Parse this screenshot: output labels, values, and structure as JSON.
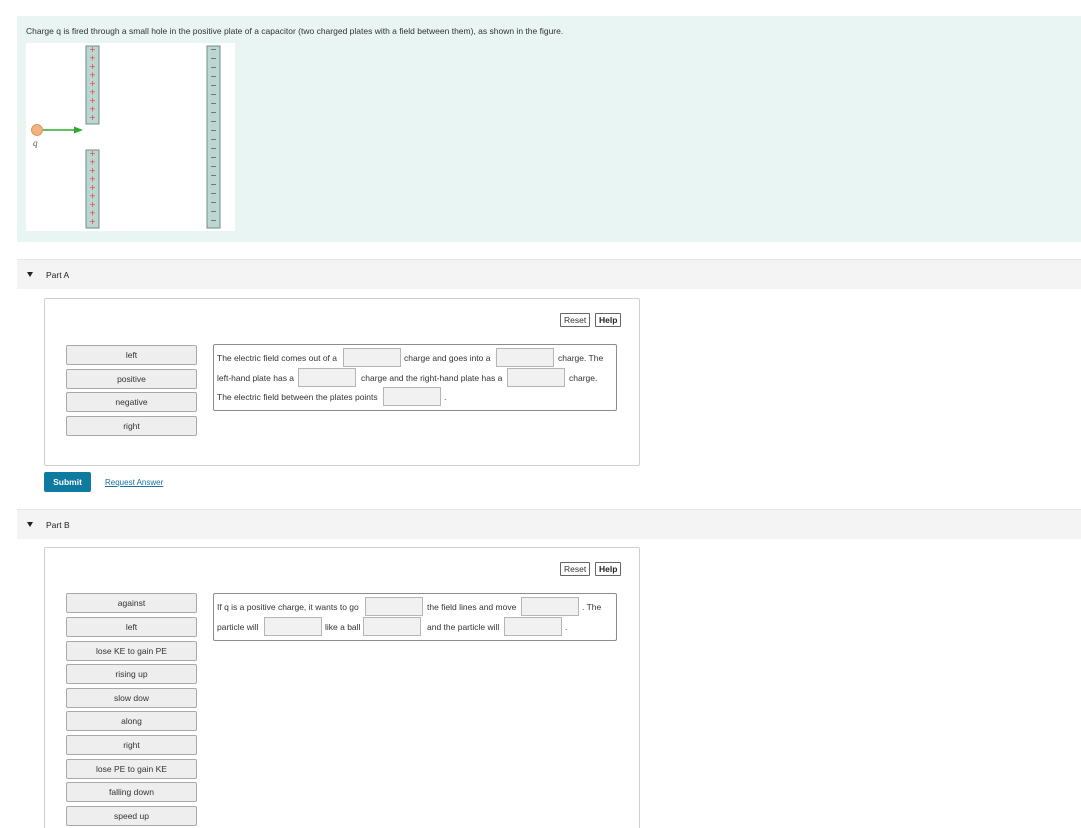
{
  "intro": {
    "text": "Charge q is fired through a small hole in the positive plate of a capacitor (two charged plates with a field between them), as shown in the figure.",
    "figure": {
      "charge_label": "q",
      "plus_sign": "+",
      "minus_sign": "−",
      "arrow_color": "#2eaa2e",
      "charge_color": "#f5b27f"
    }
  },
  "part_a": {
    "title": "Part A",
    "reset": "Reset",
    "help": "Help",
    "chips": [
      "left",
      "positive",
      "negative",
      "right"
    ],
    "sentences": [
      [
        "The electric field comes out of a",
        "charge and goes into a",
        "charge. The"
      ],
      [
        "left-hand plate has a",
        "charge and the right-hand plate has a",
        "charge."
      ],
      [
        "The electric field between the plates points",
        "."
      ]
    ]
  },
  "actions": {
    "submit": "Submit",
    "request_answer": "Request Answer"
  },
  "part_b": {
    "title": "Part B",
    "reset": "Reset",
    "help": "Help",
    "chips": [
      "against",
      "left",
      "lose KE to gain PE",
      "rising up",
      "slow dow",
      "along",
      "right",
      "lose PE to gain KE",
      "falling down",
      "speed up"
    ],
    "sentences": [
      [
        "If q is a positive charge, it wants to go",
        "the field lines and move",
        ". The"
      ],
      [
        "particle will",
        "like a ball",
        "and the particle will",
        "."
      ]
    ]
  }
}
